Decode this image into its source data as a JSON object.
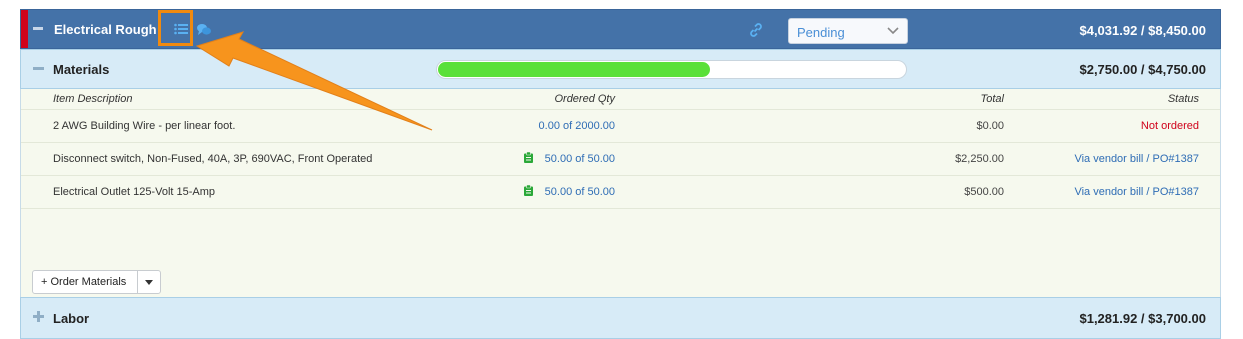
{
  "header": {
    "title": "Electrical Rough In",
    "status_value": "Pending",
    "amount": "$4,031.92 / $8,450.00",
    "icons": [
      "collapse-icon",
      "list-icon",
      "chat-icon",
      "link-icon",
      "chevron-down-icon"
    ]
  },
  "materials": {
    "title": "Materials",
    "amount": "$2,750.00 / $4,750.00",
    "progress_fraction": 0.58,
    "columns": {
      "description": "Item Description",
      "ordered_qty": "Ordered Qty",
      "total": "Total",
      "status": "Status"
    },
    "rows": [
      {
        "description": "2 AWG Building Wire - per linear foot.",
        "ordered_qty": "0.00 of 2000.00",
        "total": "$0.00",
        "status": "Not ordered",
        "status_type": "error",
        "has_clipboard": false
      },
      {
        "description": "Disconnect switch, Non-Fused, 40A, 3P, 690VAC, Front Operated",
        "ordered_qty": "50.00 of 50.00",
        "total": "$2,250.00",
        "status": "Via vendor bill / PO#1387",
        "status_type": "link",
        "has_clipboard": true
      },
      {
        "description": "Electrical Outlet 125-Volt 15-Amp",
        "ordered_qty": "50.00 of 50.00",
        "total": "$500.00",
        "status": "Via vendor bill / PO#1387",
        "status_type": "link",
        "has_clipboard": true
      }
    ],
    "order_button": "+ Order Materials"
  },
  "labor": {
    "title": "Labor",
    "amount": "$1,281.92 / $3,700.00"
  },
  "colors": {
    "header_bg": "#4472a8",
    "accent_red": "#d0021b",
    "progress_green": "#5ae039",
    "highlight_orange": "#f08a0f",
    "link_blue": "#2f6db5"
  }
}
